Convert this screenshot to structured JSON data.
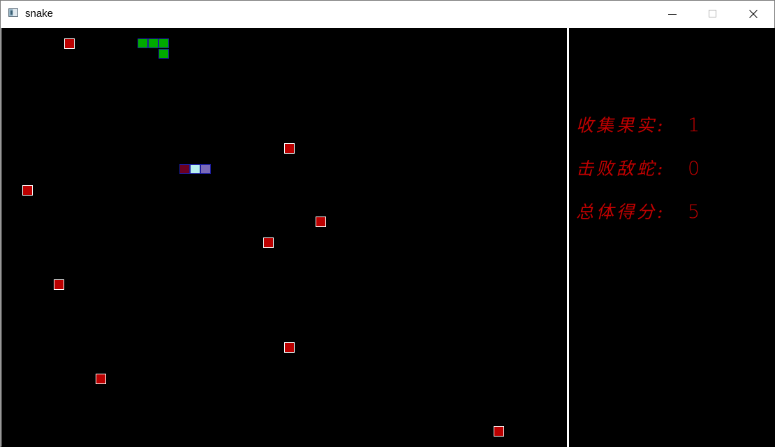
{
  "window": {
    "title": "snake",
    "icon": "app-window-icon",
    "controls": [
      "minimize-icon",
      "maximize-icon",
      "close-icon"
    ]
  },
  "colors": {
    "background": "#000000",
    "food": "#bb0000",
    "food_border": "#ffffff",
    "player_snake": "#00aa00",
    "enemy_snake": [
      "#6a0022",
      "#b8f0f0",
      "#7a6ab8"
    ],
    "segment_border": "#1c1c9c",
    "stats_text": "#c00000"
  },
  "stats": {
    "collected_label": "收集果实:",
    "collected_value": "1",
    "defeated_label": "击败敌蛇:",
    "defeated_value": "0",
    "score_label": "总体得分:",
    "score_value": "5"
  }
}
